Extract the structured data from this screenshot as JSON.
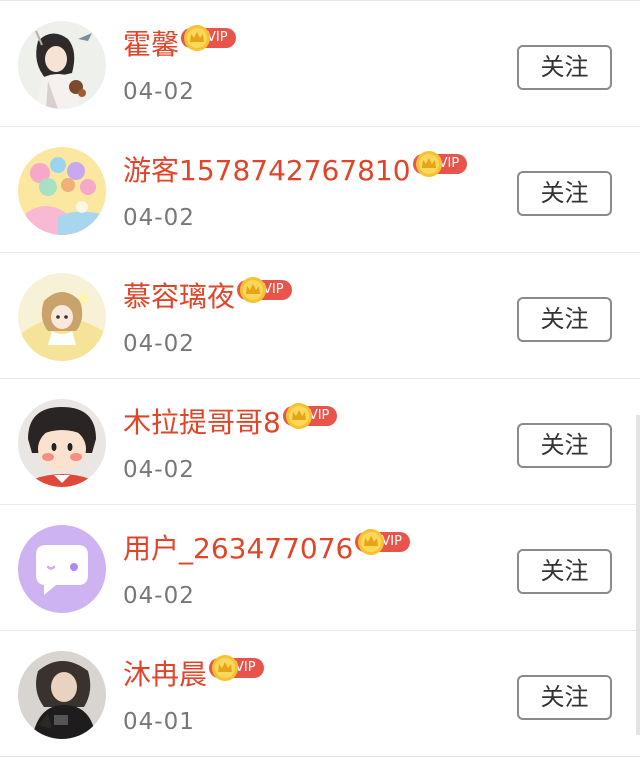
{
  "colors": {
    "name": "#e0452a",
    "vip_pill": "#e9544a",
    "crown": "#f5c232",
    "date": "#777777",
    "follow_border": "#8a8a8a"
  },
  "follow_label": "关注",
  "vip_label": "VIP",
  "users": [
    {
      "name": "霍馨",
      "date": "04-02",
      "avatar": "ancient-girl-avatar"
    },
    {
      "name": "游客1578742767810",
      "date": "04-02",
      "avatar": "lollipop-avatar"
    },
    {
      "name": "慕容璃夜",
      "date": "04-02",
      "avatar": "anime-girl-yellow-avatar"
    },
    {
      "name": "木拉提哥哥8",
      "date": "04-02",
      "avatar": "cartoon-girl-avatar"
    },
    {
      "name": "用户_263477076",
      "date": "04-02",
      "avatar": "default-chat-avatar"
    },
    {
      "name": "沐冉晨",
      "date": "04-01",
      "avatar": "photo-person-avatar"
    }
  ]
}
